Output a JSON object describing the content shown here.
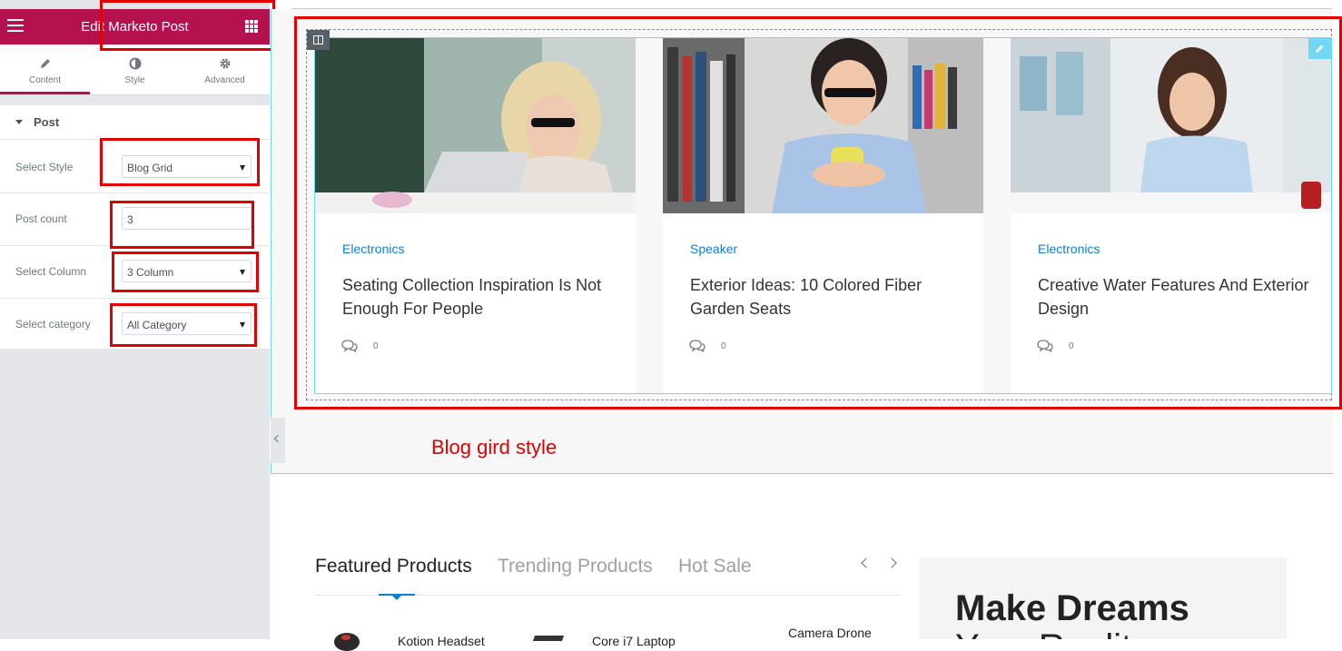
{
  "panel": {
    "title": "Edit Marketo Post",
    "tabs": [
      {
        "label": "Content",
        "icon": "pencil-icon",
        "active": true
      },
      {
        "label": "Style",
        "icon": "contrast-icon",
        "active": false
      },
      {
        "label": "Advanced",
        "icon": "gear-icon",
        "active": false
      }
    ],
    "section_title": "Post",
    "controls": {
      "style_label": "Select Style",
      "style_value": "Blog Grid",
      "count_label": "Post count",
      "count_value": "3",
      "column_label": "Select Column",
      "column_value": "3 Column",
      "category_label": "Select category",
      "category_value": "All Category"
    },
    "accent_color": "#b5114e"
  },
  "blog": {
    "posts": [
      {
        "category": "Electronics",
        "title": "Seating Collection Inspiration Is Not Enough For People",
        "comments": "0"
      },
      {
        "category": "Speaker",
        "title": "Exterior Ideas: 10 Colored Fiber Garden Seats",
        "comments": "0"
      },
      {
        "category": "Electronics",
        "title": "Creative Water Features And Exterior Design",
        "comments": "0"
      }
    ],
    "caption": "Blog gird style",
    "link_color": "#0d7fd6"
  },
  "products": {
    "tabs": [
      "Featured Products",
      "Trending Products",
      "Hot Sale"
    ],
    "items": [
      "Kotion Headset",
      "Core i7 Laptop",
      "Camera Drone"
    ]
  },
  "promo": {
    "title": "Make Dreams",
    "subtitle": "Your Reality"
  },
  "annotation_color": "#e00000"
}
